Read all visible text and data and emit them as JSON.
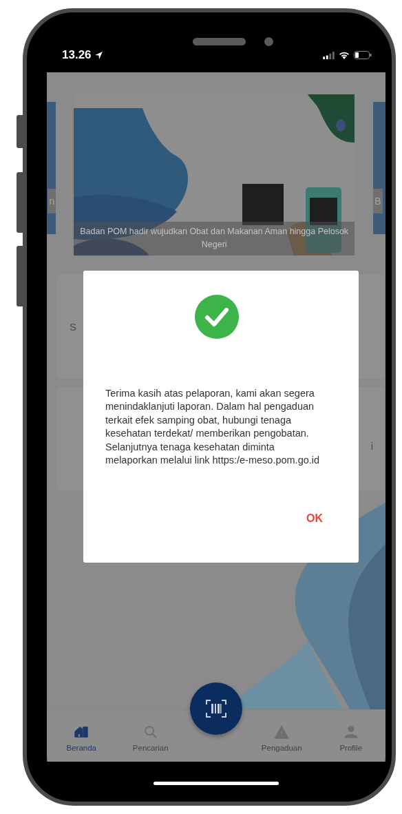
{
  "status_bar": {
    "time": "13.26"
  },
  "banner": {
    "kind": "picture",
    "caption": "Badan POM hadir wujudkan Obat dan Makanan Aman hingga Pelosok Negeri",
    "prev_caption": "n",
    "next_caption": "B"
  },
  "cards": [
    {
      "text": "S"
    },
    {
      "text": "i"
    }
  ],
  "dialog": {
    "message": "Terima kasih atas pelaporan, kami akan segera menindaklanjuti laporan. Dalam hal pengaduan terkait efek samping obat, hubungi tenaga kesehatan terdekat/ memberikan pengobatan. Selanjutnya tenaga kesehatan diminta melaporkan melalui link https:/e-meso.pom.go.id",
    "ok_button": "OK"
  },
  "tab_bar": {
    "tabs": [
      {
        "label": "Beranda",
        "kind": "home",
        "selected": true
      },
      {
        "label": "Pencarian",
        "kind": "search",
        "selected": false
      },
      {
        "label": "Pengaduan",
        "kind": "warning",
        "selected": false
      },
      {
        "label": "Profile",
        "kind": "person",
        "selected": false
      }
    ]
  }
}
